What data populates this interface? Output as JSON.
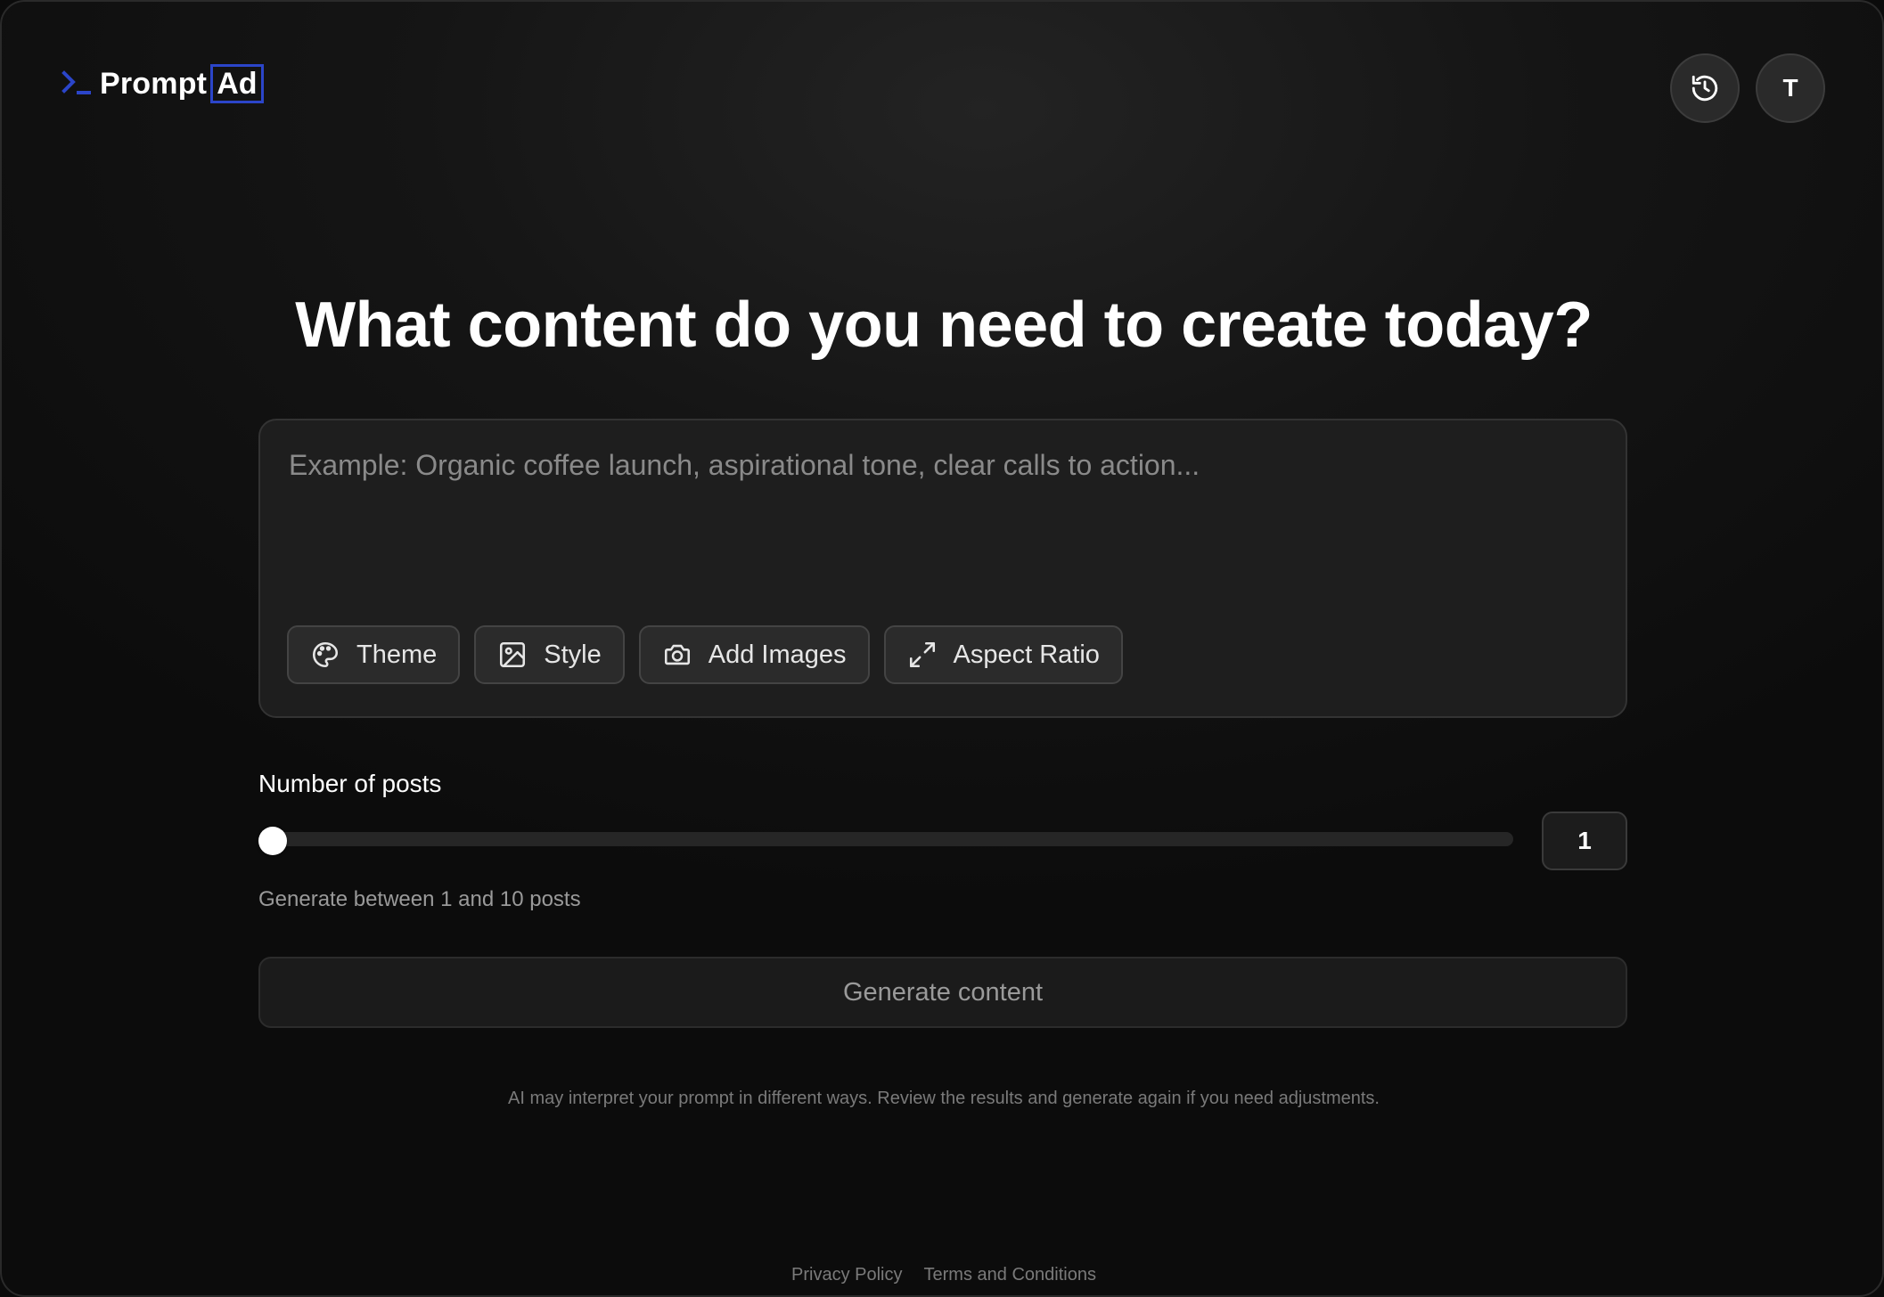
{
  "brand": {
    "name_main": "Prompt",
    "name_accent": "Ad",
    "accent_color": "#2b45c9"
  },
  "header": {
    "history_icon": "history-icon",
    "avatar_initial": "T"
  },
  "main": {
    "heading": "What content do you need to create today?",
    "prompt": {
      "placeholder": "Example: Organic coffee launch, aspirational tone, clear calls to action...",
      "value": ""
    },
    "chips": [
      {
        "label": "Theme",
        "icon": "palette-icon"
      },
      {
        "label": "Style",
        "icon": "image-icon"
      },
      {
        "label": "Add Images",
        "icon": "camera-icon"
      },
      {
        "label": "Aspect Ratio",
        "icon": "expand-icon"
      }
    ],
    "posts": {
      "label": "Number of posts",
      "value": "1",
      "min": 1,
      "max": 10,
      "helper": "Generate between 1 and 10 posts"
    },
    "generate_label": "Generate content",
    "disclaimer": "AI may interpret your prompt in different ways. Review the results and generate again if you need adjustments."
  },
  "footer": {
    "privacy": "Privacy Policy",
    "terms": "Terms and Conditions"
  }
}
